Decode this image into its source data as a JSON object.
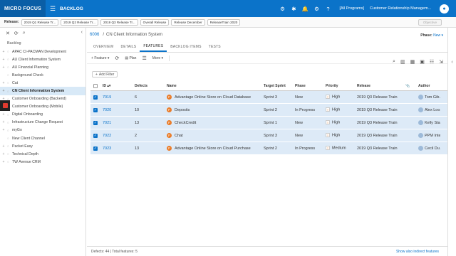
{
  "app": {
    "brand": "MICRO FOCUS",
    "module": "BACKLOG",
    "program": "[All Programs]",
    "workspace": "Customer Relationship Managem..."
  },
  "release_bar": {
    "label": "Release:",
    "chips": [
      "2019 Q1 Release Tr...",
      "2019 Q2 Release Tr...",
      "2019 Q3 Release Tr...",
      "Overall Release",
      "Release December",
      "ReleaseTrain 2020"
    ],
    "objective": "Objective"
  },
  "tree": {
    "root": "Backlog",
    "items": [
      {
        "label": "APAC CI-PACMAN Development",
        "toggle": "+"
      },
      {
        "label": "AU Client Information System",
        "toggle": "+"
      },
      {
        "label": "AU Financial Planning",
        "toggle": "+"
      },
      {
        "label": "Background Check",
        "toggle": ""
      },
      {
        "label": "Cat",
        "toggle": "+"
      },
      {
        "label": "CN Client Information System",
        "toggle": "+",
        "selected": true
      },
      {
        "label": "Customer Onboarding (Backend)",
        "toggle": "+"
      },
      {
        "label": "Customer Onboarding (Mobile)",
        "toggle": "+"
      },
      {
        "label": "Digital Onboarding",
        "toggle": "+"
      },
      {
        "label": "Infrastructure Change Request",
        "toggle": "+"
      },
      {
        "label": "myGo",
        "toggle": "+"
      },
      {
        "label": "New Client Channel",
        "toggle": ""
      },
      {
        "label": "Packet Easy",
        "toggle": "+"
      },
      {
        "label": "Technical Depth",
        "toggle": "+"
      },
      {
        "label": "TW Avenue CRM",
        "toggle": "+"
      }
    ]
  },
  "breadcrumb": {
    "id": "6006",
    "sep": "/",
    "title": "CN Client Information System"
  },
  "phase": {
    "label": "Phase:",
    "value": "New"
  },
  "tabs": [
    "OVERVIEW",
    "DETAILS",
    "FEATURES",
    "BACKLOG ITEMS",
    "TESTS"
  ],
  "active_tab": "FEATURES",
  "toolbar": {
    "feature": "Feature",
    "plan": "Plan",
    "more": "More",
    "add_filter": "Add Filter"
  },
  "grid": {
    "headers": {
      "id": "ID",
      "defects": "Defects",
      "name": "Name",
      "sprint": "Target Sprint",
      "phase": "Phase",
      "priority": "Priority",
      "release": "Release",
      "author": "Author"
    },
    "rows": [
      {
        "id": "7019",
        "defects": "6",
        "name": "Advantage Online Store on Cloud Database",
        "sprint": "Sprint 3",
        "phase": "New",
        "priority": "High",
        "release": "2019 Q3 Release Train",
        "author": "Tom Gib..."
      },
      {
        "id": "7020",
        "defects": "10",
        "name": "Deposits",
        "sprint": "Sprint 2",
        "phase": "In Progress",
        "priority": "High",
        "release": "2019 Q3 Release Train",
        "author": "Alex Loo..."
      },
      {
        "id": "7021",
        "defects": "13",
        "name": "CheckCredit",
        "sprint": "Sprint 1",
        "phase": "New",
        "priority": "High",
        "release": "2019 Q3 Release Train",
        "author": "Kelly Sta..."
      },
      {
        "id": "7022",
        "defects": "2",
        "name": "Chat",
        "sprint": "Sprint 3",
        "phase": "New",
        "priority": "High",
        "release": "2019 Q3 Release Train",
        "author": "PPM Inter..."
      },
      {
        "id": "7023",
        "defects": "13",
        "name": "Advantage Online Store on Cloud Purchase",
        "sprint": "Sprint 2",
        "phase": "In Progress",
        "priority": "Medium",
        "release": "2019 Q3 Release Train",
        "author": "Cecil Du..."
      }
    ]
  },
  "status": {
    "text": "Defects: 44 | Total features: 5",
    "link": "Show also indirect features"
  },
  "colors": {
    "topbar": "#0b73c9",
    "brand_bg": "#0a5ea6",
    "row_selected": "#ddeaf7",
    "feature_badge": "#ea7b27"
  }
}
